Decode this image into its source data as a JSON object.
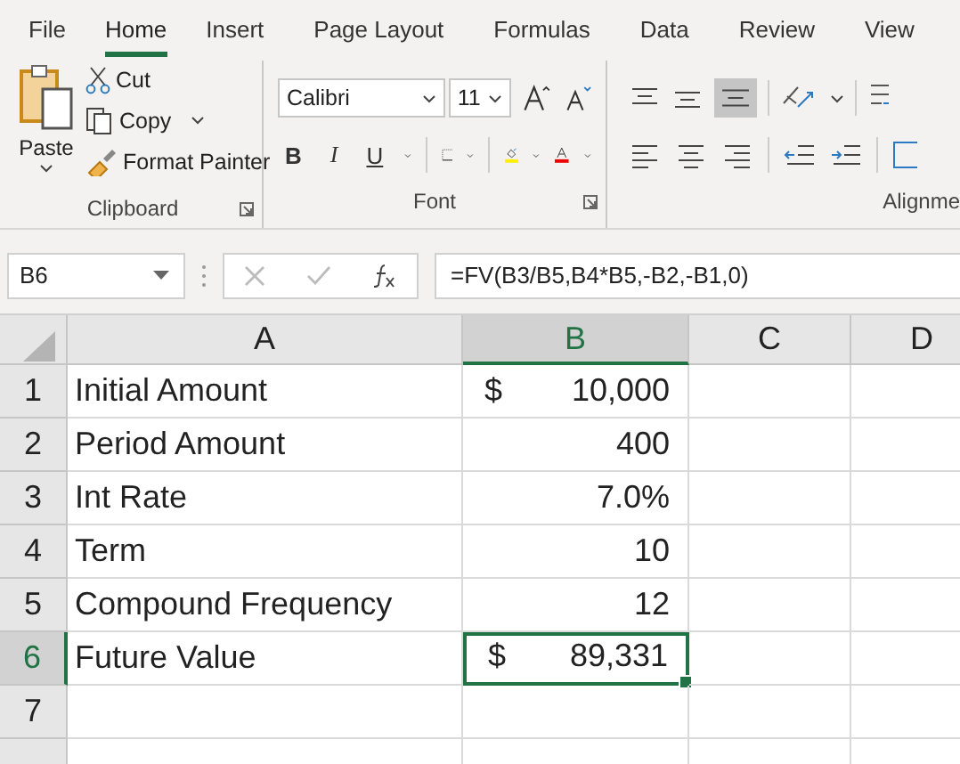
{
  "menu_tabs": [
    {
      "label": "File",
      "selected": false
    },
    {
      "label": "Home",
      "selected": true
    },
    {
      "label": "Insert",
      "selected": false
    },
    {
      "label": "Page Layout",
      "selected": false
    },
    {
      "label": "Formulas",
      "selected": false
    },
    {
      "label": "Data",
      "selected": false
    },
    {
      "label": "Review",
      "selected": false
    },
    {
      "label": "View",
      "selected": false
    }
  ],
  "clipboard": {
    "paste": "Paste",
    "cut": "Cut",
    "copy": "Copy",
    "format_painter": "Format Painter",
    "group_label": "Clipboard"
  },
  "font": {
    "font_name": "Calibri",
    "font_size": "11",
    "bold": "B",
    "italic": "I",
    "underline": "U",
    "group_label": "Font"
  },
  "alignment": {
    "group_label": "Alignme",
    "bottom_align_selected": true
  },
  "formula_bar": {
    "name_box": "B6",
    "formula": "=FV(B3/B5,B4*B5,-B2,-B1,0)"
  },
  "columns": [
    {
      "label": "A",
      "selected": false
    },
    {
      "label": "B",
      "selected": true
    },
    {
      "label": "C",
      "selected": false
    },
    {
      "label": "D",
      "selected": false
    }
  ],
  "rows": [
    {
      "number": "1",
      "selected": false,
      "label": "Initial Amount",
      "currency": "$",
      "value": "10,000"
    },
    {
      "number": "2",
      "selected": false,
      "label": "Period Amount",
      "value": "400"
    },
    {
      "number": "3",
      "selected": false,
      "label": "Int Rate",
      "value": "7.0%"
    },
    {
      "number": "4",
      "selected": false,
      "label": "Term",
      "value": "10"
    },
    {
      "number": "5",
      "selected": false,
      "label": "Compound Frequency",
      "value": "12"
    },
    {
      "number": "6",
      "selected": true,
      "label": "Future Value",
      "currency": "$",
      "value": "89,331"
    },
    {
      "number": "7",
      "selected": false
    },
    {
      "selected": false
    }
  ]
}
